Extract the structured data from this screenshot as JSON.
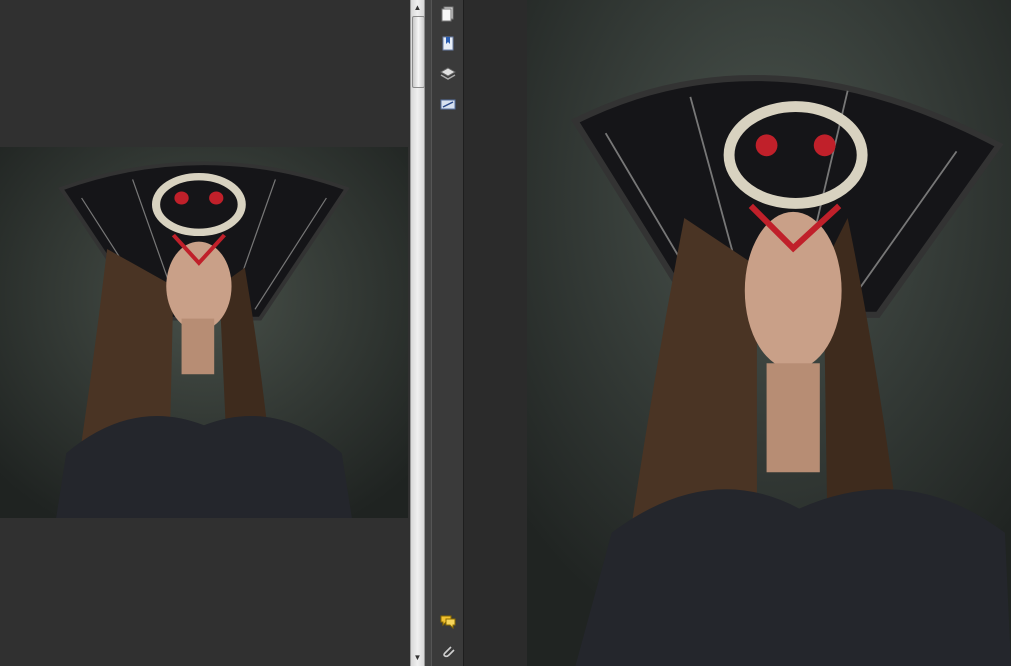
{
  "app": {
    "left_view": {
      "background": "#303030",
      "photo_label": ""
    },
    "right_view": {
      "background": "#2b2b2b"
    }
  },
  "nav_panel": {
    "buttons": [
      {
        "icon": "pages-icon",
        "tooltip": ""
      },
      {
        "icon": "bookmarks-icon",
        "tooltip": ""
      },
      {
        "icon": "layers-icon",
        "tooltip": ""
      },
      {
        "icon": "signatures-icon",
        "tooltip": ""
      },
      {
        "icon": "comments-icon",
        "tooltip": ""
      },
      {
        "icon": "attachments-icon",
        "tooltip": ""
      }
    ]
  },
  "colors": {
    "backdrop": "#2f3330",
    "headdress": "#151518",
    "crown": "#d8d2c0",
    "jewel_red": "#c0202a",
    "hair": "#4a3424",
    "skin": "#c9a088",
    "robe": "#24262c"
  }
}
